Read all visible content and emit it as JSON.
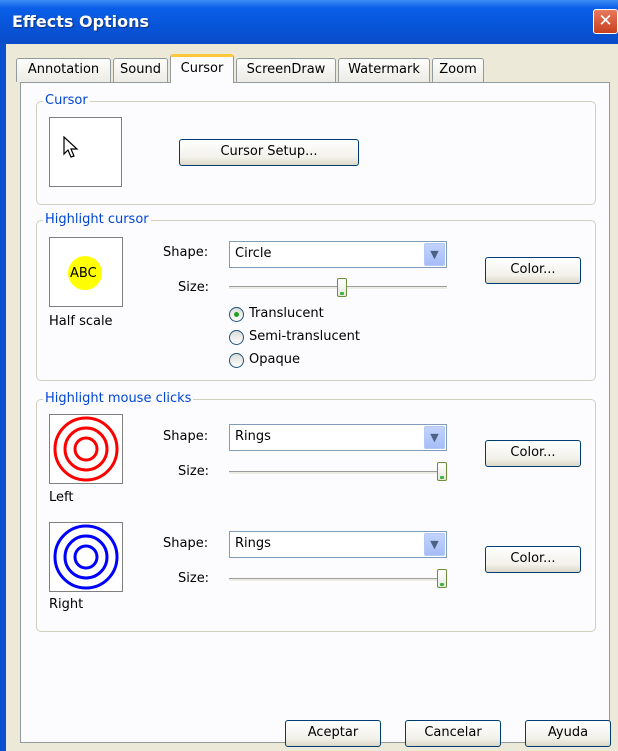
{
  "window": {
    "title": "Effects Options",
    "close_glyph": "✕"
  },
  "tabs": [
    "Annotation",
    "Sound",
    "Cursor",
    "ScreenDraw",
    "Watermark",
    "Zoom"
  ],
  "active_tab": "Cursor",
  "cursor_group": {
    "label": "Cursor",
    "setup_button": "Cursor Setup..."
  },
  "highlight_cursor": {
    "label": "Highlight cursor",
    "preview_text": "ABC",
    "preview_caption": "Half scale",
    "shape_label": "Shape:",
    "shape_value": "Circle",
    "size_label": "Size:",
    "size_level": 0.52,
    "color_button": "Color...",
    "highlight_color": "#ffff00",
    "opacity_options": [
      {
        "label": "Translucent",
        "checked": true
      },
      {
        "label": "Semi-translucent",
        "checked": false
      },
      {
        "label": "Opaque",
        "checked": false
      }
    ]
  },
  "mouse_clicks": {
    "label": "Highlight mouse clicks",
    "left": {
      "caption": "Left",
      "shape_label": "Shape:",
      "shape_value": "Rings",
      "size_label": "Size:",
      "size_level": 1.0,
      "color_button": "Color...",
      "ring_color": "#ff0000"
    },
    "right": {
      "caption": "Right",
      "shape_label": "Shape:",
      "shape_value": "Rings",
      "size_label": "Size:",
      "size_level": 1.0,
      "color_button": "Color...",
      "ring_color": "#0000ff"
    }
  },
  "footer": {
    "ok": "Aceptar",
    "cancel": "Cancelar",
    "help": "Ayuda"
  },
  "colors": {
    "titlebar": "#0a5fe8",
    "dialog_bg": "#ece9d8",
    "group_label": "#0046d5",
    "active_tab_accent": "#ffc83c"
  }
}
